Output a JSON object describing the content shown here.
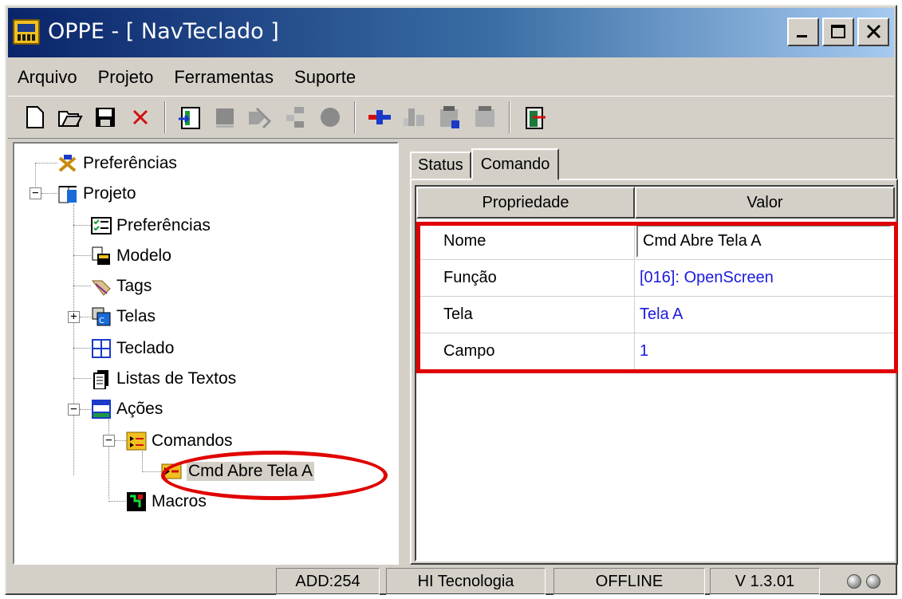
{
  "window": {
    "title": "OPPE - [ NavTeclado ]",
    "controls": [
      "minimize-icon",
      "maximize-icon",
      "close-icon"
    ]
  },
  "menu": {
    "items": [
      "Arquivo",
      "Projeto",
      "Ferramentas",
      "Suporte"
    ]
  },
  "toolbar": {
    "buttons": [
      "new-file-icon",
      "open-folder-icon",
      "save-icon",
      "delete-icon",
      "import-icon",
      "block-icon",
      "tags-icon",
      "tree-icon",
      "record-icon",
      "connect-icon",
      "transfer-icon",
      "hardware-icon",
      "module-icon",
      "exit-icon"
    ]
  },
  "tree": {
    "items": [
      {
        "label": "Preferências",
        "icon": "tools-icon"
      },
      {
        "label": "Projeto",
        "icon": "project-icon"
      },
      {
        "label": "Preferências",
        "icon": "checklist-icon"
      },
      {
        "label": "Modelo",
        "icon": "model-icon"
      },
      {
        "label": "Tags",
        "icon": "tags-icon"
      },
      {
        "label": "Telas",
        "icon": "screens-icon"
      },
      {
        "label": "Teclado",
        "icon": "keyboard-icon"
      },
      {
        "label": "Listas de Textos",
        "icon": "text-list-icon"
      },
      {
        "label": "Ações",
        "icon": "actions-icon"
      },
      {
        "label": "Comandos",
        "icon": "commands-icon"
      },
      {
        "label": "Cmd Abre Tela A",
        "icon": "command-icon"
      },
      {
        "label": "Macros",
        "icon": "macros-icon"
      }
    ]
  },
  "tabs": [
    "Status",
    "Comando"
  ],
  "active_tab": "Comando",
  "grid": {
    "headers": [
      "Propriedade",
      "Valor"
    ],
    "rows": [
      {
        "prop": "Nome",
        "value": "Cmd Abre Tela A"
      },
      {
        "prop": "Função",
        "value": "[016]: OpenScreen"
      },
      {
        "prop": "Tela",
        "value": "Tela A"
      },
      {
        "prop": "Campo",
        "value": "1"
      }
    ]
  },
  "status": {
    "address": "ADD:254",
    "company": "HI Tecnologia",
    "connection": "OFFLINE",
    "version": "V 1.3.01"
  },
  "colors": {
    "highlight": "#e00000",
    "link_value": "#1a1adc",
    "title_start": "#0a246a",
    "title_end": "#a6caf0"
  }
}
